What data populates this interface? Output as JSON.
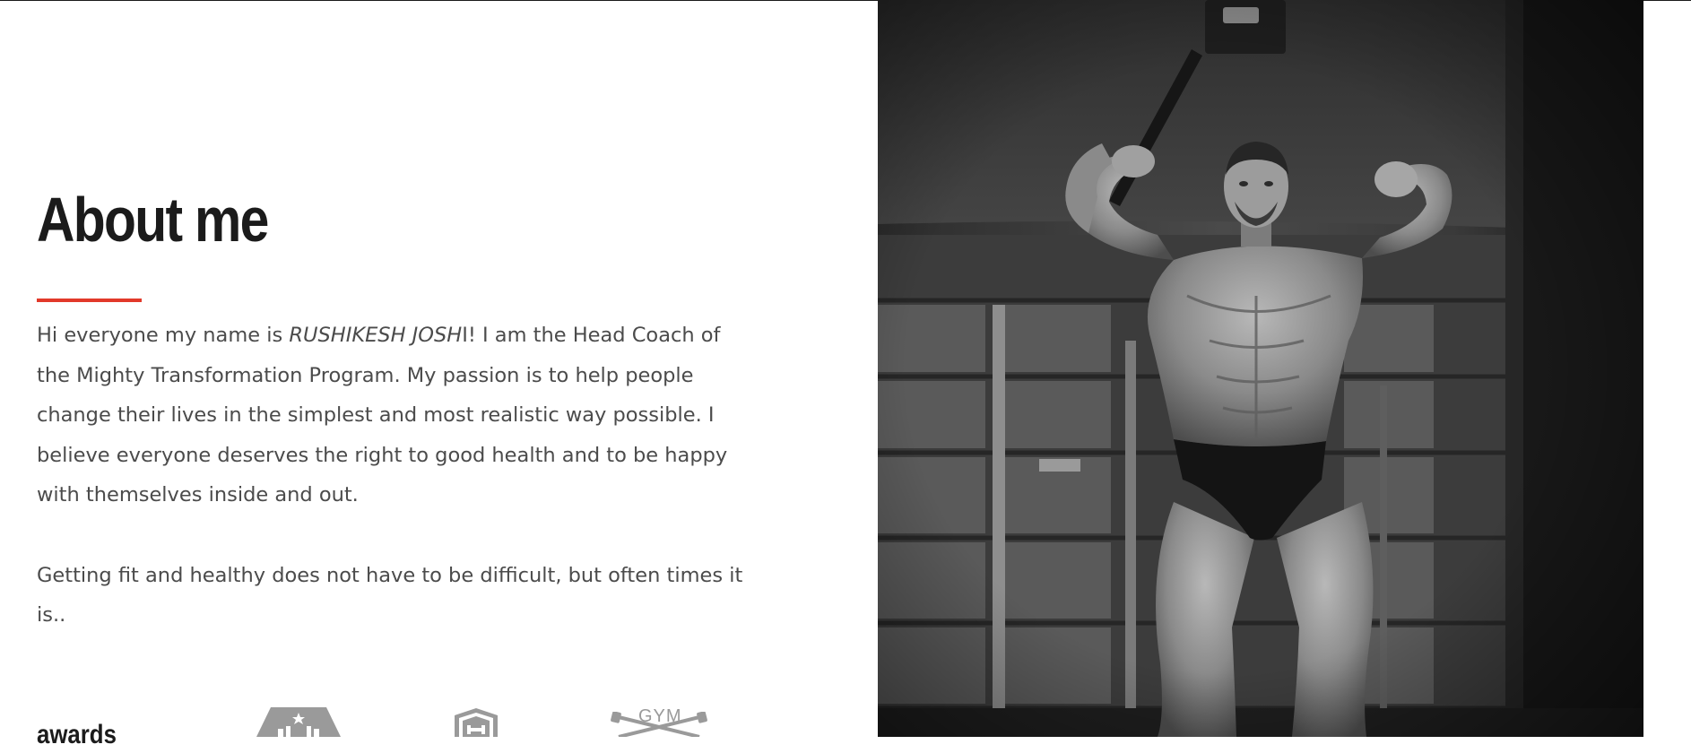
{
  "about": {
    "title": "About me",
    "bio_intro": "Hi everyone my name is ",
    "bio_name": "RUSHIKESH JOSH",
    "bio_rest": "I!  I am the Head Coach of the Mighty Transformation Program.  My passion is to help people change their lives in the simplest and most realistic way possible. I believe everyone deserves the right to good health and to be happy with themselves inside and out.",
    "bio_more": "Getting fit and healthy does not have to be difficult, but often times it is..",
    "awards_label": "awards",
    "badge_gym_text": "GYM"
  },
  "colors": {
    "accent": "#e2392a",
    "heading": "#1b1b1b",
    "body_text": "#4b4b4b",
    "badge_grey": "#9a9a9a"
  },
  "photo": {
    "subject": "black-and-white bodybuilder double biceps pose"
  }
}
